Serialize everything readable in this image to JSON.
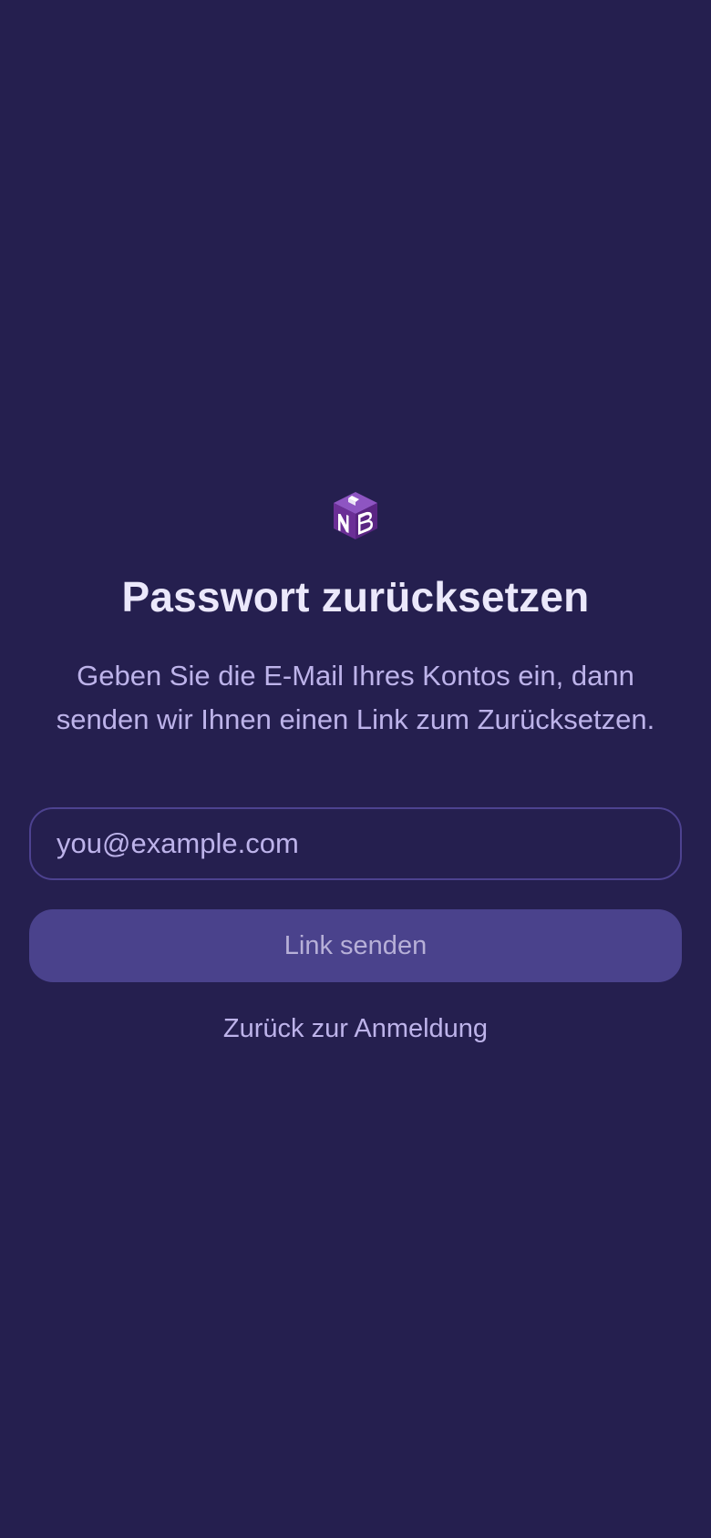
{
  "app": {
    "logo_icon": "nb-cube-logo-icon",
    "logo_text": "NB"
  },
  "reset": {
    "title": "Passwort zurücksetzen",
    "description": "Geben Sie die E-Mail Ihres Kontos ein, dann senden wir Ihnen einen Link zum Zurücksetzen.",
    "email_value": "",
    "email_placeholder": "you@example.com",
    "send_label": "Link senden",
    "back_label": "Zurück zur Anmeldung"
  },
  "colors": {
    "background": "#251f4f",
    "title_text": "#ebe8fb",
    "muted_text": "#bdb3ea",
    "input_border": "#4d4290",
    "button_background": "#4a428c",
    "logo_purple": "#7b3fa6"
  }
}
